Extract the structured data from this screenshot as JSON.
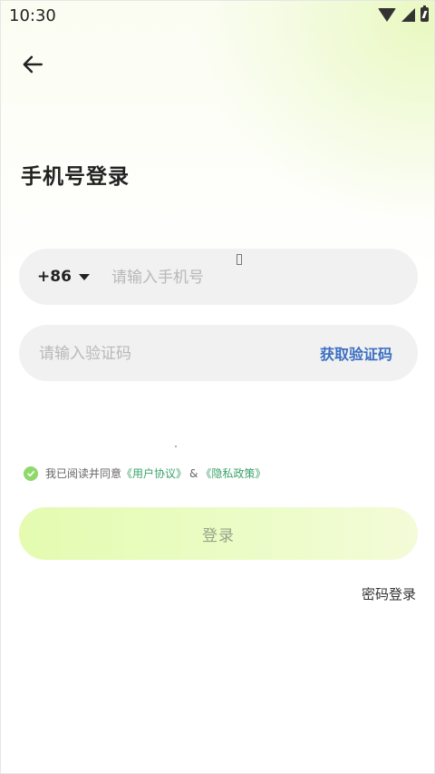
{
  "status_bar": {
    "time": "10:30"
  },
  "page": {
    "title": "手机号登录"
  },
  "phone": {
    "country_code": "+86",
    "placeholder": "请输入手机号",
    "value": ""
  },
  "code": {
    "placeholder": "请输入验证码",
    "value": "",
    "get_code_label": "获取验证码"
  },
  "agreement": {
    "prefix": "我已阅读并同意",
    "user_agreement": "《用户协议》",
    "amp": "&",
    "privacy_policy": "《隐私政策》",
    "checked": true
  },
  "login_button": {
    "label": "登录"
  },
  "password_login": {
    "label": "密码登录"
  },
  "colors": {
    "accent_link": "#3b6fc2",
    "check_green": "#8fd96a",
    "policy_link": "#3aa36a"
  }
}
